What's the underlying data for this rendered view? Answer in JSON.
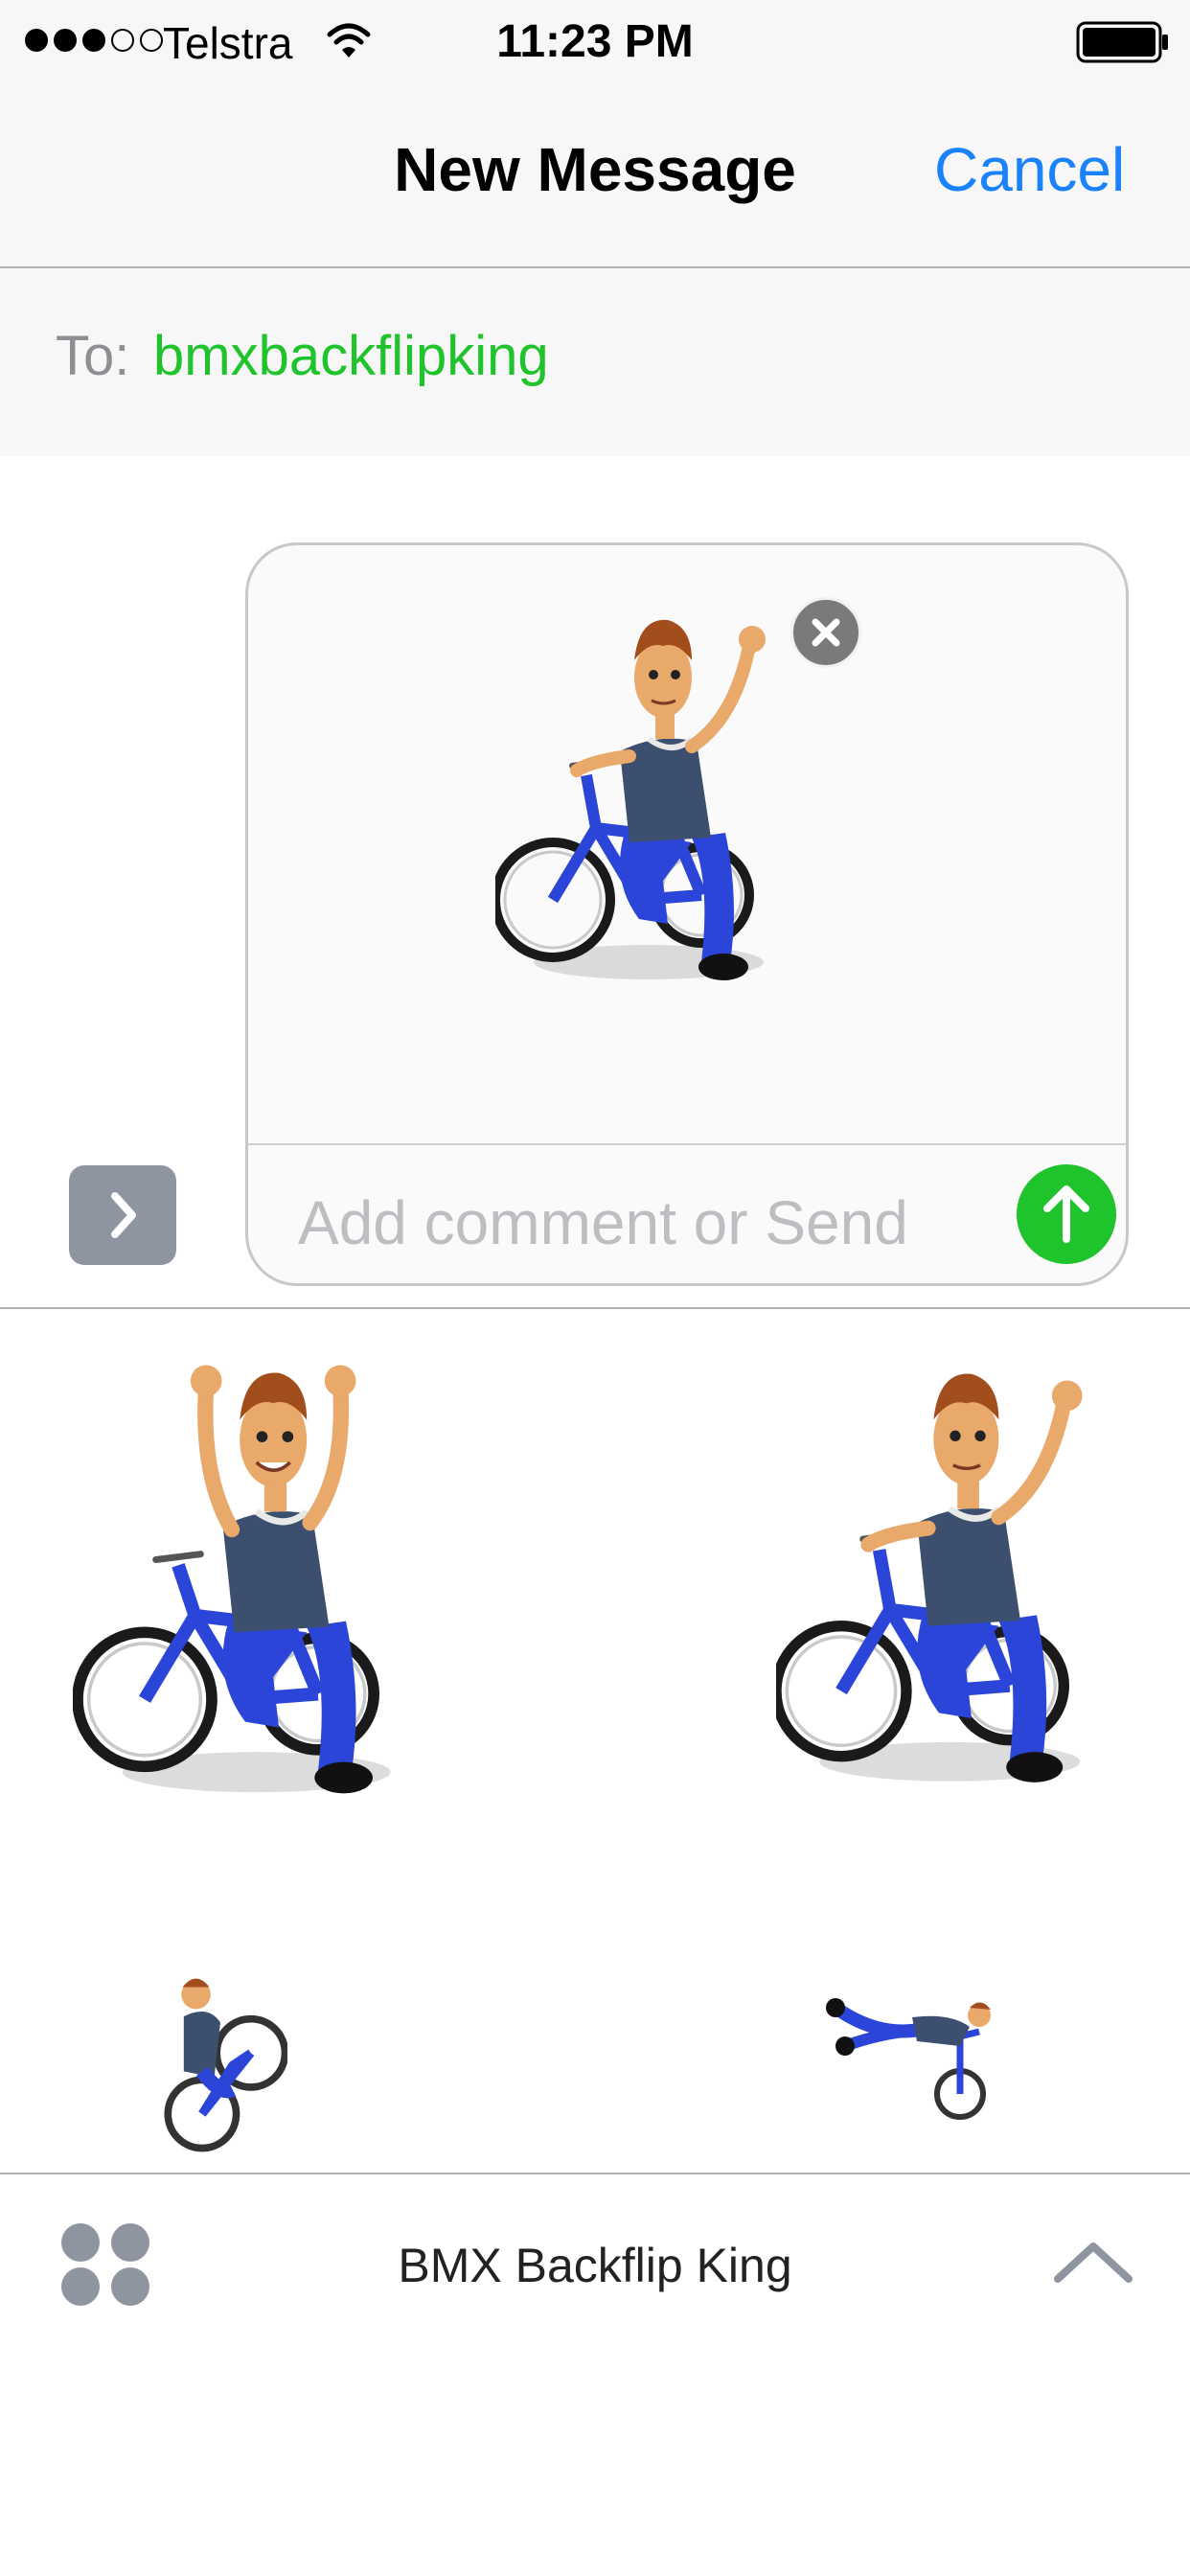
{
  "status_bar": {
    "carrier": "Telstra",
    "time": "11:23 PM",
    "signal_bars_filled": 3,
    "signal_bars_total": 5
  },
  "nav": {
    "title": "New Message",
    "cancel_label": "Cancel"
  },
  "recipient": {
    "label": "To:",
    "value": "bmxbackflipking"
  },
  "compose": {
    "placeholder": "Add comment or Send"
  },
  "stickers": [
    {
      "name": "waving-on-bike-sticker",
      "selected": true
    },
    {
      "name": "cheering-on-bike-sticker"
    },
    {
      "name": "waving-on-bike-sticker"
    },
    {
      "name": "wheelie-sticker"
    },
    {
      "name": "superman-trick-sticker"
    }
  ],
  "bottom_bar": {
    "app_name": "BMX Backflip King"
  },
  "colors": {
    "accent_blue": "#1a82fb",
    "imessage_green": "#1fc32b",
    "shirt": "#3c4f6e",
    "pants_bike_blue": "#2a45d8"
  }
}
